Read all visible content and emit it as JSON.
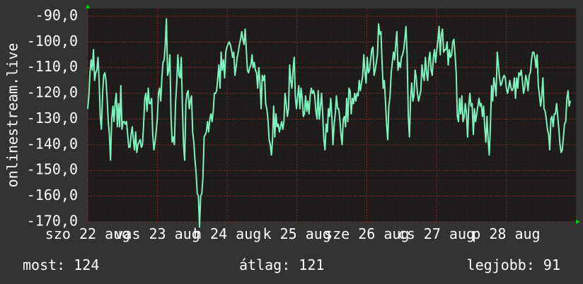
{
  "colors": {
    "background": "#333333",
    "plot": "#1c1c1c",
    "line": "#7ef2bd",
    "grid": "#6b2222",
    "axis_arrow": "#00d000"
  },
  "chart_data": {
    "type": "line",
    "title": "",
    "xlabel": "",
    "ylabel": "onlinestream.live",
    "ylim": [
      -170,
      -87
    ],
    "grid": true,
    "y_ticks": [
      -90,
      -100,
      -110,
      -120,
      -130,
      -140,
      -150,
      -160,
      -170
    ],
    "y_tick_labels": [
      "-90,0",
      "-100,0",
      "-110,0",
      "-120,0",
      "-130,0",
      "-140,0",
      "-150,0",
      "-160,0",
      "-170,0"
    ],
    "x_day_labels": [
      "szo 22 aug",
      "vas 23 aug",
      "h 24 aug",
      "k 25 aug",
      "sze 26 aug",
      "cs 27 aug",
      "p 28 aug"
    ],
    "series": [
      {
        "values": [
          -126,
          -121,
          -112,
          -107,
          -111,
          -103,
          -115,
          -112,
          -111,
          -106,
          -115,
          -129,
          -134,
          -120,
          -113,
          -112,
          -115,
          -122,
          -131,
          -136,
          -146,
          -130,
          -125,
          -131,
          -124,
          -120,
          -133,
          -124,
          -133,
          -117,
          -134,
          -131,
          -131,
          -132,
          -131,
          -136,
          -141,
          -141,
          -136,
          -133,
          -138,
          -142,
          -135,
          -143,
          -140,
          -139,
          -138,
          -141,
          -140,
          -132,
          -122,
          -120,
          -127,
          -118,
          -124,
          -124,
          -122,
          -136,
          -142,
          -139,
          -135,
          -130,
          -120,
          -118,
          -123,
          -114,
          -108,
          -107,
          -101,
          -91,
          -113,
          -111,
          -105,
          -129,
          -139,
          -137,
          -140,
          -124,
          -116,
          -105,
          -113,
          -114,
          -106,
          -125,
          -140,
          -146,
          -124,
          -120,
          -119,
          -126,
          -123,
          -121,
          -135,
          -139,
          -146,
          -151,
          -159,
          -160,
          -172,
          -160,
          -159,
          -153,
          -137,
          -136,
          -135,
          -131,
          -135,
          -130,
          -128,
          -131,
          -127,
          -120,
          -120,
          -119,
          -114,
          -109,
          -118,
          -104,
          -111,
          -107,
          -114,
          -104,
          -102,
          -101,
          -100,
          -101,
          -103,
          -106,
          -104,
          -113,
          -110,
          -106,
          -104,
          -101,
          -99,
          -96,
          -99,
          -101,
          -95,
          -103,
          -111,
          -112,
          -110,
          -109,
          -105,
          -110,
          -108,
          -111,
          -112,
          -118,
          -110,
          -116,
          -126,
          -113,
          -115,
          -113,
          -124,
          -126,
          -130,
          -138,
          -140,
          -144,
          -138,
          -125,
          -137,
          -128,
          -133,
          -132,
          -135,
          -133,
          -131,
          -134,
          -131,
          -120,
          -124,
          -129,
          -126,
          -109,
          -115,
          -118,
          -111,
          -106,
          -121,
          -126,
          -121,
          -117,
          -126,
          -118,
          -122,
          -129,
          -128,
          -121,
          -127,
          -123,
          -128,
          -121,
          -118,
          -120,
          -119,
          -121,
          -127,
          -130,
          -119,
          -130,
          -125,
          -120,
          -128,
          -138,
          -142,
          -132,
          -135,
          -126,
          -129,
          -122,
          -129,
          -140,
          -132,
          -128,
          -121,
          -126,
          -126,
          -130,
          -136,
          -140,
          -130,
          -129,
          -133,
          -122,
          -131,
          -118,
          -119,
          -128,
          -122,
          -124,
          -120,
          -123,
          -120,
          -121,
          -115,
          -119,
          -116,
          -113,
          -105,
          -112,
          -116,
          -106,
          -112,
          -111,
          -107,
          -103,
          -102,
          -113,
          -111,
          -108,
          -105,
          -93,
          -97,
          -96,
          -108,
          -118,
          -115,
          -123,
          -132,
          -138,
          -125,
          -121,
          -112,
          -108,
          -104,
          -107,
          -101,
          -96,
          -111,
          -108,
          -110,
          -106,
          -105,
          -103,
          -99,
          -94,
          -105,
          -129,
          -137,
          -122,
          -116,
          -123,
          -121,
          -111,
          -114,
          -120,
          -123,
          -121,
          -119,
          -109,
          -113,
          -115,
          -106,
          -112,
          -115,
          -107,
          -104,
          -111,
          -113,
          -106,
          -103,
          -108,
          -103,
          -99,
          -94,
          -105,
          -97,
          -95,
          -104,
          -103,
          -103,
          -100,
          -109,
          -103,
          -106,
          -105,
          -100,
          -99,
          -105,
          -112,
          -129,
          -131,
          -122,
          -128,
          -121,
          -131,
          -129,
          -124,
          -128,
          -137,
          -125,
          -120,
          -125,
          -124,
          -136,
          -126,
          -131,
          -128,
          -125,
          -122,
          -125,
          -124,
          -129,
          -125,
          -133,
          -139,
          -129,
          -138,
          -144,
          -133,
          -117,
          -123,
          -114,
          -117,
          -121,
          -104,
          -109,
          -114,
          -117,
          -116,
          -114,
          -113,
          -114,
          -118,
          -120,
          -118,
          -115,
          -118,
          -119,
          -118,
          -114,
          -122,
          -114,
          -118,
          -112,
          -113,
          -111,
          -115,
          -120,
          -118,
          -113,
          -115,
          -119,
          -113,
          -112,
          -107,
          -104,
          -104,
          -106,
          -110,
          -105,
          -117,
          -121,
          -125,
          -121,
          -114,
          -126,
          -127,
          -130,
          -134,
          -136,
          -142,
          -130,
          -129,
          -133,
          -128,
          -128,
          -124,
          -129,
          -134,
          -140,
          -143,
          -142,
          -137,
          -132,
          -131,
          -122,
          -119,
          -125,
          -123
        ]
      }
    ],
    "stats": [
      {
        "label": "most:",
        "value": "124"
      },
      {
        "label": "átlag:",
        "value": "121"
      },
      {
        "label": "legjobb:",
        "value": "91"
      }
    ]
  }
}
